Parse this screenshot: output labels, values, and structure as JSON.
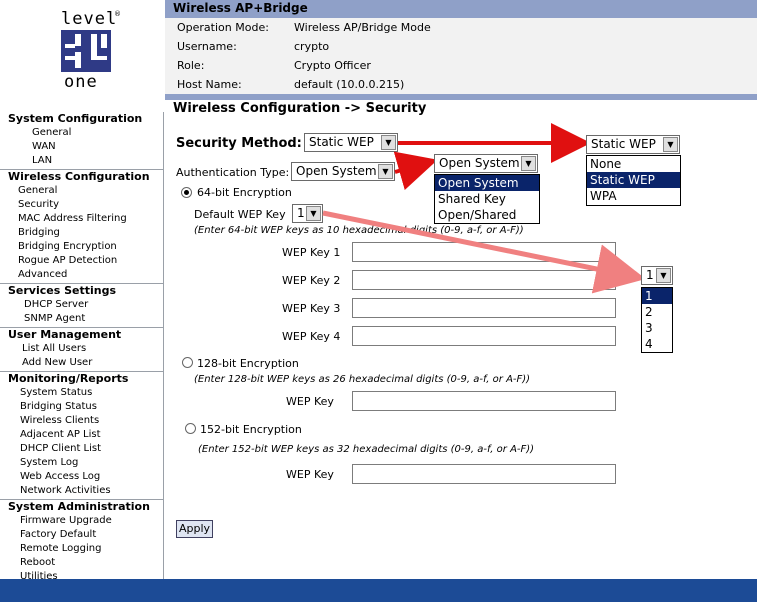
{
  "logo": {
    "top_text": "level",
    "bottom_text": "one",
    "reg_mark": "®"
  },
  "header": {
    "title": "Wireless AP+Bridge",
    "info": [
      {
        "label": "Operation Mode:",
        "value": "Wireless AP/Bridge Mode"
      },
      {
        "label": "Username:",
        "value": "crypto"
      },
      {
        "label": "Role:",
        "value": "Crypto Officer"
      },
      {
        "label": "Host Name:",
        "value": "default (10.0.0.215)"
      }
    ]
  },
  "sidebar": {
    "sections": [
      {
        "title": "System Configuration",
        "items": [
          "General",
          "WAN",
          "LAN"
        ]
      },
      {
        "title": "Wireless Configuration",
        "items": [
          "General",
          "Security",
          "MAC Address Filtering",
          "Bridging",
          "Bridging Encryption",
          "Rogue AP Detection",
          "Advanced"
        ]
      },
      {
        "title": "Services Settings",
        "items": [
          "DHCP Server",
          "SNMP Agent"
        ]
      },
      {
        "title": "User Management",
        "items": [
          "List All Users",
          "Add New User"
        ]
      },
      {
        "title": "Monitoring/Reports",
        "items": [
          "System Status",
          "Bridging Status",
          "Wireless Clients",
          "Adjacent AP List",
          "DHCP Client List",
          "System Log",
          "Web Access Log",
          "Network Activities"
        ]
      },
      {
        "title": "System Administration",
        "items": [
          "Firmware Upgrade",
          "Factory Default",
          "Remote Logging",
          "Reboot",
          "Utilities"
        ]
      }
    ]
  },
  "main": {
    "page_title": "Wireless Configuration -> Security",
    "security_method_label": "Security Method:",
    "security_method_value": "Static WEP",
    "auth_type_label": "Authentication Type:",
    "auth_type_value": "Open System",
    "enc64": {
      "label": "64-bit Encryption",
      "default_key_label": "Default WEP Key",
      "default_key_value": "1",
      "note": "(Enter 64-bit WEP keys as 10 hexadecimal digits (0-9, a-f, or A-F))",
      "keys": [
        "WEP Key 1",
        "WEP Key 2",
        "WEP Key 3",
        "WEP Key 4"
      ]
    },
    "enc128": {
      "label": "128-bit Encryption",
      "note": "(Enter 128-bit WEP keys as 26 hexadecimal digits (0-9, a-f, or A-F))",
      "key_label": "WEP Key"
    },
    "enc152": {
      "label": "152-bit Encryption",
      "note": "(Enter 152-bit WEP keys as 32 hexadecimal digits (0-9, a-f, or A-F))",
      "key_label": "WEP Key"
    },
    "apply_label": "Apply"
  },
  "popups": {
    "security_method": {
      "value": "Static WEP",
      "options": [
        "None",
        "Static WEP",
        "WPA"
      ],
      "selected": 1
    },
    "auth_type": {
      "value": "Open System",
      "options": [
        "Open System",
        "Shared Key",
        "Open/Shared"
      ],
      "selected": 0
    },
    "wep_key": {
      "value": "1",
      "options": [
        "1",
        "2",
        "3",
        "4"
      ],
      "selected": 0
    }
  },
  "colors": {
    "header_bar": "#8fa0c8",
    "footer_bar": "#1c4b96",
    "highlight": "#0a246a",
    "arrow": "#e01010"
  },
  "icons": {
    "dropdown_arrow": "chevron-down-icon"
  }
}
